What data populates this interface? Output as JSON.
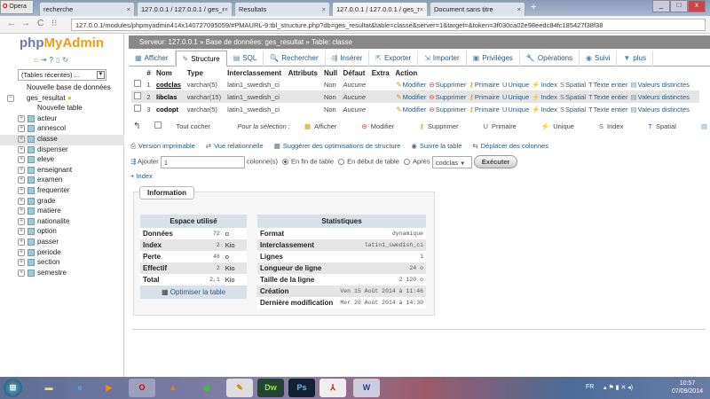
{
  "browser": {
    "opera_label": "Opera",
    "tabs": [
      {
        "label": "recherche"
      },
      {
        "label": "127.0.0.1 / 127.0.0.1 / ges_r"
      },
      {
        "label": "Resultats"
      },
      {
        "label": "127.0.0.1 / 127.0.0.1 / ges_r",
        "active": true
      },
      {
        "label": "Document sans titre"
      }
    ],
    "url": "127.0.0.1/modules/phpmyadmin414x140727095059/#PMAURL-9:tbl_structure.php?db=ges_resultat&table=classe&server=1&target=&token=3f030ca02e98eedc84fc185427f38f38"
  },
  "sidebar": {
    "logo_php": "php",
    "logo_my": "MyAdmin",
    "recent": "(Tables récentes) ...",
    "new_db": "Nouvelle base de données",
    "db": "ges_resultat",
    "new_table": "Nouvelle table",
    "tables": [
      "acteur",
      "annescol",
      "classe",
      "dispenser",
      "eleve",
      "enseignant",
      "examen",
      "frequenter",
      "grade",
      "matiere",
      "nationalite",
      "option",
      "passer",
      "periode",
      "section",
      "semestre"
    ],
    "selected": "classe"
  },
  "breadcrumb": {
    "server": "Serveur: 127.0.0.1",
    "sep1": "»",
    "db": "Base de données: ges_resultat",
    "sep2": "»",
    "table": "Table: classe"
  },
  "tabs": [
    "Afficher",
    "Structure",
    "SQL",
    "Rechercher",
    "Insérer",
    "Exporter",
    "Importer",
    "Privilèges",
    "Opérations",
    "Suivi",
    "plus"
  ],
  "tab_icons": [
    "▦",
    "✎",
    "▤",
    "🔍",
    "⇶",
    "⇱",
    "⇲",
    "▣",
    "🔧",
    "◉",
    "▼"
  ],
  "structure": {
    "headers": [
      "#",
      "Nom",
      "Type",
      "Interclassement",
      "Attributs",
      "Null",
      "Défaut",
      "Extra",
      "Action"
    ],
    "rows": [
      {
        "num": "1",
        "name": "codclas",
        "type": "varchar(5)",
        "coll": "latin1_swedish_ci",
        "attr": "",
        "null": "Non",
        "default": "Aucune",
        "extra": ""
      },
      {
        "num": "2",
        "name": "libclas",
        "type": "varchar(15)",
        "coll": "latin1_swedish_ci",
        "attr": "",
        "null": "Non",
        "default": "Aucune",
        "extra": ""
      },
      {
        "num": "3",
        "name": "codopt",
        "type": "varchar(5)",
        "coll": "latin1_swedish_ci",
        "attr": "",
        "null": "Non",
        "default": "Aucune",
        "extra": ""
      }
    ],
    "actions": [
      "Modifier",
      "Supprimer",
      "Primaire",
      "Unique",
      "Index",
      "Spatial",
      "Texte entier",
      "Valeurs distinctes"
    ]
  },
  "bulk": {
    "check_all": "Tout cocher",
    "for_selection": "Pour la sélection :",
    "actions": [
      "Afficher",
      "Modifier",
      "Supprimer",
      "Primaire",
      "Unique",
      "Index",
      "Spatial",
      "Texte entier"
    ]
  },
  "links": [
    "Version imprimable",
    "Vue relationnelle",
    "Suggérer des optimisations de structure",
    "Suivre la table",
    "Déplacer des colonnes"
  ],
  "add": {
    "label": "Ajouter",
    "count": "1",
    "columns": "colonne(s)",
    "end": "En fin de table",
    "start": "En début de table",
    "after": "Après",
    "after_col": "codclas",
    "execute": "Exécuter"
  },
  "plus_index": "+ Index",
  "info": {
    "legend": "Information",
    "space": {
      "title": "Espace utilisé",
      "rows": [
        {
          "k": "Données",
          "v": "72",
          "u": "o"
        },
        {
          "k": "Index",
          "v": "2",
          "u": "Kio"
        },
        {
          "k": "Perte",
          "v": "48",
          "u": "o"
        },
        {
          "k": "Effectif",
          "v": "2",
          "u": "Kio"
        },
        {
          "k": "Total",
          "v": "2,1",
          "u": "Kio"
        }
      ],
      "optimize": "Optimiser la table"
    },
    "stats": {
      "title": "Statistiques",
      "rows": [
        {
          "k": "Format",
          "v": "dynamique"
        },
        {
          "k": "Interclassement",
          "v": "latin1_swedish_ci"
        },
        {
          "k": "Lignes",
          "v": "1"
        },
        {
          "k": "Longueur de ligne",
          "v": "24 o"
        },
        {
          "k": "Taille de la ligne",
          "v": "2 120 o"
        },
        {
          "k": "Création",
          "v": "Ven 15 Août 2014 à 11:46"
        },
        {
          "k": "Dernière modification",
          "v": "Mer 20 Août 2014 à 14:30"
        }
      ]
    }
  },
  "taskbar": {
    "apps": [
      "Dw",
      "Ps"
    ],
    "lang": "FR",
    "time": "10:57",
    "date": "07/09/2014"
  }
}
